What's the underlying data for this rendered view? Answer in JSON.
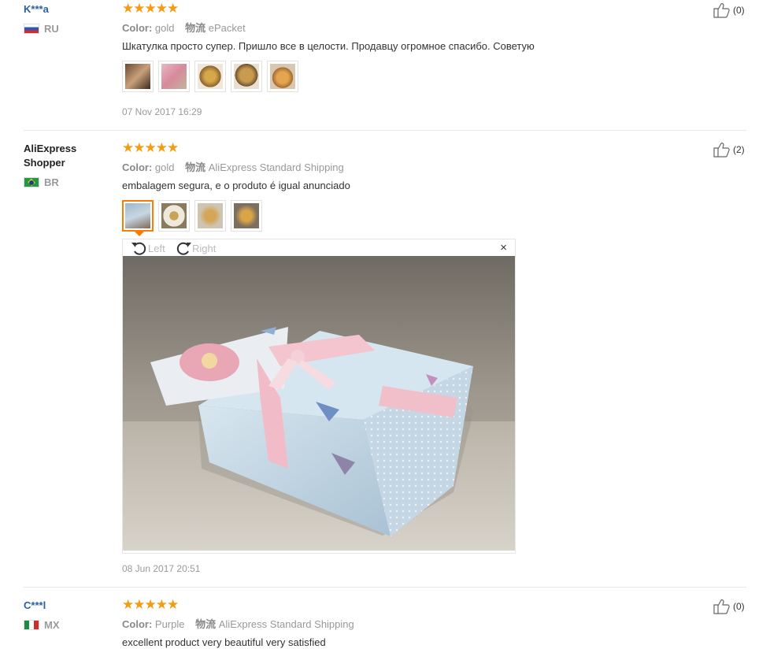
{
  "reviews": [
    {
      "user": "K***a",
      "country": "RU",
      "rating": "★★★★★",
      "color_label": "Color:",
      "color_value": "gold",
      "shipping_label": "物流",
      "shipping_value": "ePacket",
      "text": "Шкатулка просто супер. Пришло все в целости. Продавцу огромное спасибо. Советую",
      "date": "07 Nov 2017 16:29",
      "likes": "(0)"
    },
    {
      "user": "AliExpress Shopper",
      "country": "BR",
      "rating": "★★★★★",
      "color_label": "Color:",
      "color_value": "gold",
      "shipping_label": "物流",
      "shipping_value": "AliExpress Standard Shipping",
      "text": "embalagem segura, e o produto é igual anunciado",
      "date": "08 Jun 2017 20:51",
      "likes": "(2)"
    },
    {
      "user": "C***l",
      "country": "MX",
      "rating": "★★★★★",
      "color_label": "Color:",
      "color_value": "Purple",
      "shipping_label": "物流",
      "shipping_value": "AliExpress Standard Shipping",
      "text": "excellent product very beautiful very satisfied",
      "likes": "(0)"
    }
  ],
  "viewer": {
    "rotate_left": "Left",
    "rotate_right": "Right",
    "close": "×"
  },
  "colors": {
    "star": "#f39c12",
    "active_thumb": "#ff7a00",
    "user_link": "#2a5fa8"
  }
}
